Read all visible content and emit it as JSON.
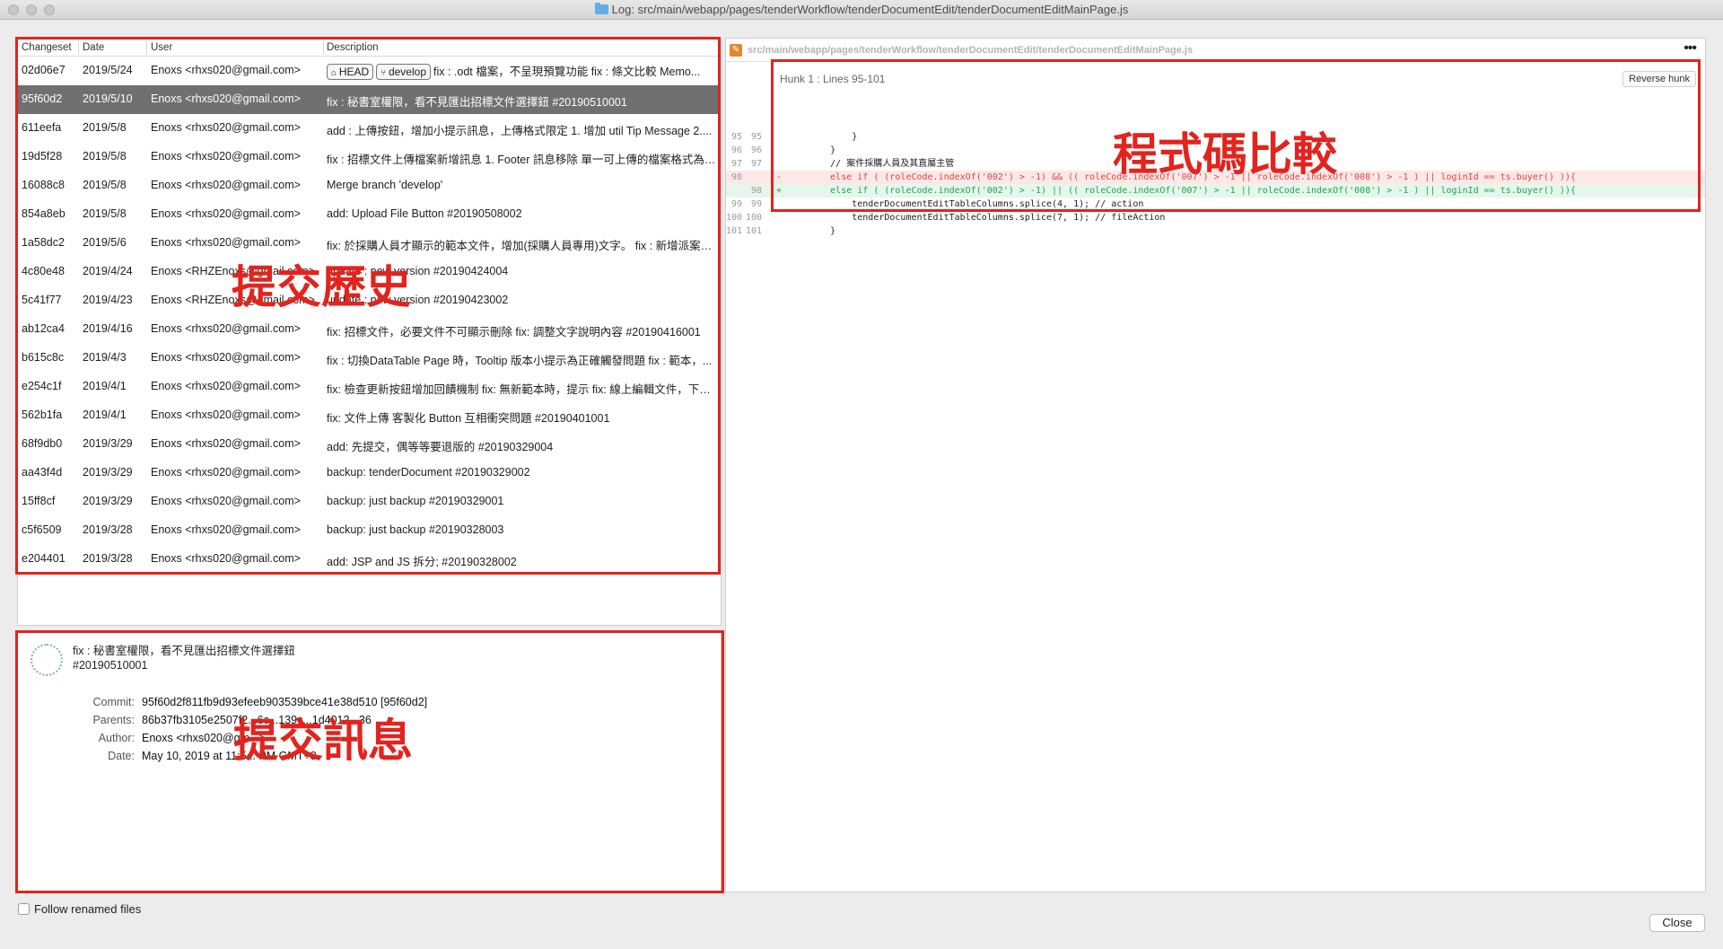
{
  "window": {
    "title": "Log: src/main/webapp/pages/tenderWorkflow/tenderDocumentEdit/tenderDocumentEditMainPage.js"
  },
  "log": {
    "headers": {
      "changeset": "Changeset",
      "date": "Date",
      "user": "User",
      "description": "Description"
    },
    "rows": [
      {
        "changeset": "02d06e7",
        "date": "2019/5/24",
        "user": "Enoxs <rhxs020@gmail.com>",
        "tags": [
          "HEAD",
          "develop"
        ],
        "description": "fix : .odt 檔案，不呈現預覽功能 fix : 條文比較 Memo..."
      },
      {
        "changeset": "95f60d2",
        "date": "2019/5/10",
        "user": "Enoxs <rhxs020@gmail.com>",
        "description": "fix : 秘書室權限，看不見匯出招標文件選擇鈕 #20190510001"
      },
      {
        "changeset": "611eefa",
        "date": "2019/5/8",
        "user": "Enoxs <rhxs020@gmail.com>",
        "description": "add : 上傳按鈕，增加小提示訊息，上傳格式限定 1. 增加 util Tip Message 2...."
      },
      {
        "changeset": "19d5f28",
        "date": "2019/5/8",
        "user": "Enoxs <rhxs020@gmail.com>",
        "description": "fix : 招標文件上傳檔案新增訊息 1. Footer 訊息移除 單一可上傳的檔案格式為.d..."
      },
      {
        "changeset": "16088c8",
        "date": "2019/5/8",
        "user": "Enoxs <rhxs020@gmail.com>",
        "description": "Merge branch 'develop'"
      },
      {
        "changeset": "854a8eb",
        "date": "2019/5/8",
        "user": "Enoxs <rhxs020@gmail.com>",
        "description": "add: Upload File Button #20190508002"
      },
      {
        "changeset": "1a58dc2",
        "date": "2019/5/6",
        "user": "Enoxs <rhxs020@gmail.com>",
        "description": "fix: 於採購人員才顯示的範本文件，增加(採購人員專用)文字。 fix : 新增派案時..."
      },
      {
        "changeset": "4c80e48",
        "date": "2019/4/24",
        "user": "Enoxs <RHZEnoxs@gmail.com>",
        "description": "update : new version #20190424004"
      },
      {
        "changeset": "5c41f77",
        "date": "2019/4/23",
        "user": "Enoxs <RHZEnoxs@gmail.com>",
        "description": "update : new version #20190423002"
      },
      {
        "changeset": "ab12ca4",
        "date": "2019/4/16",
        "user": "Enoxs <rhxs020@gmail.com>",
        "description": "fix: 招標文件，必要文件不可顯示刪除 fix: 調整文字說明內容 #20190416001"
      },
      {
        "changeset": "b615c8c",
        "date": "2019/4/3",
        "user": "Enoxs <rhxs020@gmail.com>",
        "description": "fix : 切換DataTable Page 時，Tooltip 版本小提示為正確觸發問題 fix : 範本，..."
      },
      {
        "changeset": "e254c1f",
        "date": "2019/4/1",
        "user": "Enoxs <rhxs020@gmail.com>",
        "description": "fix: 檢查更新按鈕增加回饋機制 fix: 無新範本時，提示 fix: 線上編輯文件，下載..."
      },
      {
        "changeset": "562b1fa",
        "date": "2019/4/1",
        "user": "Enoxs <rhxs020@gmail.com>",
        "description": "fix: 文件上傳 客製化 Button 互相衝突問題 #20190401001"
      },
      {
        "changeset": "68f9db0",
        "date": "2019/3/29",
        "user": "Enoxs <rhxs020@gmail.com>",
        "description": "add: 先提交，偶等等要退版的 #20190329004"
      },
      {
        "changeset": "aa43f4d",
        "date": "2019/3/29",
        "user": "Enoxs <rhxs020@gmail.com>",
        "description": "backup: tenderDocument #20190329002"
      },
      {
        "changeset": "15ff8cf",
        "date": "2019/3/29",
        "user": "Enoxs <rhxs020@gmail.com>",
        "description": "backup: just backup #20190329001"
      },
      {
        "changeset": "c5f6509",
        "date": "2019/3/28",
        "user": "Enoxs <rhxs020@gmail.com>",
        "description": "backup: just backup #20190328003"
      },
      {
        "changeset": "e204401",
        "date": "2019/3/28",
        "user": "Enoxs <rhxs020@gmail.com>",
        "description": "add: JSP and JS 拆分; #20190328002"
      }
    ]
  },
  "detail": {
    "message_line1": "fix : 秘書室權限，看不見匯出招標文件選擇鈕",
    "message_line2": "#20190510001",
    "fields": [
      {
        "key": "Commit:",
        "value": "95f60d2f811fb9d93efeeb903539bce41e38d510 [95f60d2]"
      },
      {
        "key": "Parents:",
        "value": "86b37fb3105e2507f2...6c...139c...1d4012...36"
      },
      {
        "key": "Author:",
        "value": "Enoxs <rhxs020@gm...>"
      },
      {
        "key": "Date:",
        "value": "May 10, 2019 at 11:5... PM GMT+8"
      }
    ]
  },
  "diff": {
    "path": "src/main/webapp/pages/tenderWorkflow/tenderDocumentEdit/tenderDocumentEditMainPage.js",
    "more_label": "•••",
    "hunk_title": "Hunk 1 : Lines 95-101",
    "reverse_label": "Reverse hunk",
    "lines": [
      {
        "old": "95",
        "new": "95",
        "sign": "",
        "type": "ctx",
        "text": "            }"
      },
      {
        "old": "96",
        "new": "96",
        "sign": "",
        "type": "ctx",
        "text": "        }"
      },
      {
        "old": "97",
        "new": "97",
        "sign": "",
        "type": "ctx",
        "text": "        // 案件採購人員及其直屬主管"
      },
      {
        "old": "98",
        "new": "",
        "sign": "-",
        "type": "del",
        "text": "        else if ( (roleCode.indexOf('002') > -1) && (( roleCode.indexOf('007') > -1 || roleCode.indexOf('008') > -1 ) || loginId == ts.buyer() )){"
      },
      {
        "old": "",
        "new": "98",
        "sign": "+",
        "type": "add",
        "text": "        else if ( (roleCode.indexOf('002') > -1) || (( roleCode.indexOf('007') > -1 || roleCode.indexOf('008') > -1 ) || loginId == ts.buyer() )){"
      },
      {
        "old": "99",
        "new": "99",
        "sign": "",
        "type": "ctx",
        "text": "            tenderDocumentEditTableColumns.splice(4, 1); // action"
      },
      {
        "old": "100",
        "new": "100",
        "sign": "",
        "type": "ctx",
        "text": "            tenderDocumentEditTableColumns.splice(7, 1); // fileAction"
      },
      {
        "old": "101",
        "new": "101",
        "sign": "",
        "type": "ctx",
        "text": "        }"
      }
    ]
  },
  "annotations": {
    "history": "提交歷史",
    "message": "提交訊息",
    "compare": "程式碼比較"
  },
  "footer": {
    "follow_renamed": "Follow renamed files",
    "close": "Close"
  },
  "colors": {
    "annotation": "#e3231d",
    "selected_row": "#707070",
    "diff_del": "#e0453a",
    "diff_add": "#1ea35a"
  }
}
